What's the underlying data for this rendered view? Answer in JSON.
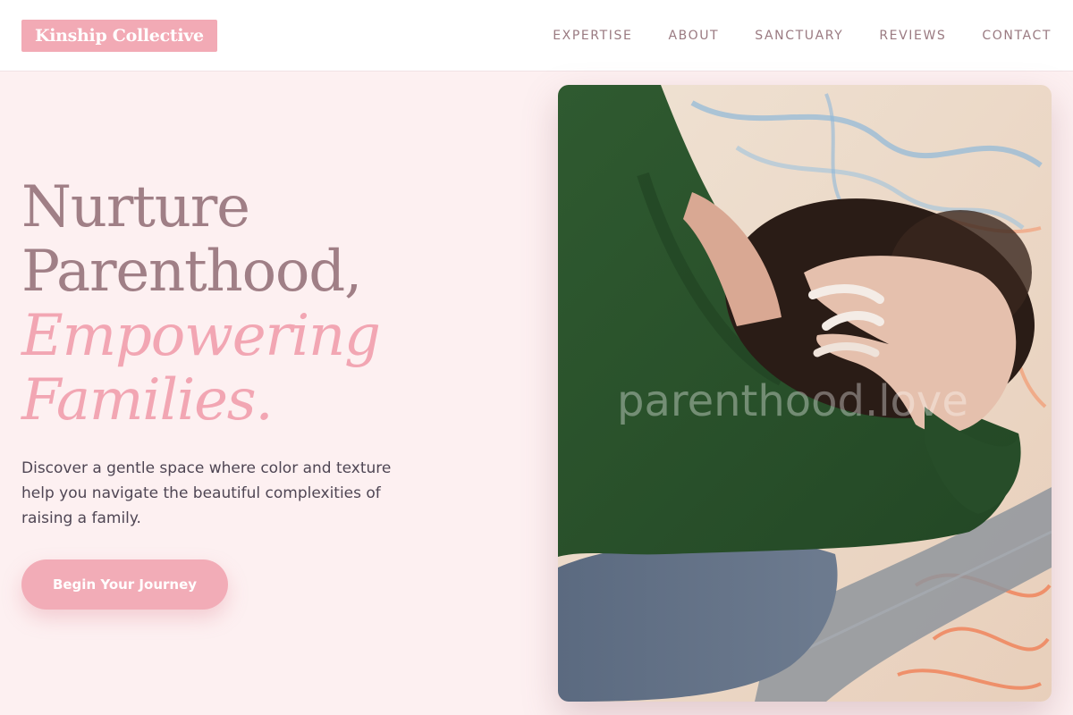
{
  "brand": {
    "name": "Kinship Collective",
    "accent_color": "#f2aab5"
  },
  "nav": {
    "items": [
      {
        "label": "EXPERTISE"
      },
      {
        "label": "ABOUT"
      },
      {
        "label": "SANCTUARY"
      },
      {
        "label": "REVIEWS"
      },
      {
        "label": "CONTACT"
      }
    ]
  },
  "hero": {
    "headline_line1": "Nurture",
    "headline_line2": "Parenthood,",
    "headline_accent1": "Empowering",
    "headline_accent2": "Families.",
    "subtext": "Discover a gentle space where color and texture help you navigate the beautiful complexities of raising a family.",
    "cta_label": "Begin Your Journey",
    "photo_watermark": "parenthood.love"
  }
}
